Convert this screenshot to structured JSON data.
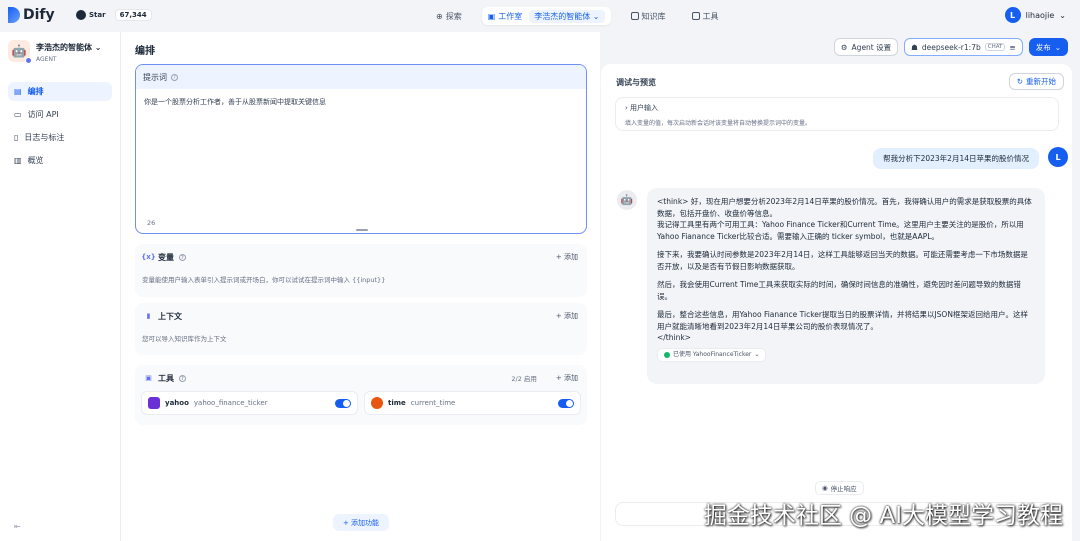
{
  "topbar": {
    "brand": "Dify",
    "star_label": "Star",
    "star_count": "67,344",
    "nav": [
      {
        "label": "探索"
      },
      {
        "label": "工作室",
        "pill": "李浩杰的智能体"
      },
      {
        "label": "知识库"
      },
      {
        "label": "工具"
      }
    ],
    "user_initial": "L",
    "user_name": "lihaojie"
  },
  "sidebar": {
    "app_name": "李浩杰的智能体",
    "app_type": "AGENT",
    "items": [
      {
        "label": "编排",
        "icon": "compose-icon"
      },
      {
        "label": "访问 API",
        "icon": "api-icon"
      },
      {
        "label": "日志与标注",
        "icon": "log-icon"
      },
      {
        "label": "概览",
        "icon": "overview-icon"
      }
    ]
  },
  "orchestrate": {
    "title": "编排",
    "prompt_label": "提示词",
    "prompt_text": "你是一个股票分析工作者，善于从股票新闻中提取关键信息",
    "prompt_count": "26",
    "variables": {
      "title": "变量",
      "add": "+ 添加",
      "desc": "变量能使用户输入表单引入提示词或开场白，你可以试试在提示词中输入 {{input}}"
    },
    "context": {
      "title": "上下文",
      "add": "+ 添加",
      "desc": "您可以导入知识库作为上下文"
    },
    "tools": {
      "title": "工具",
      "meta": "2/2 启用",
      "add": "+ 添加",
      "items": [
        {
          "name": "yahoo",
          "sub": "yahoo_finance_ticker",
          "color": "#6b2fd6"
        },
        {
          "name": "time",
          "sub": "current_time",
          "color": "#e8560f"
        }
      ]
    },
    "add_feature": "+ 添加功能"
  },
  "header_buttons": {
    "agent_settings": "Agent 设置",
    "model": "deepseek-r1:7b",
    "model_tag": "CHAT",
    "publish": "发布"
  },
  "preview": {
    "title": "调试与预览",
    "restart": "重新开始",
    "user_input_title": "用户输入",
    "user_input_desc": "填入变量的值，每次启动新会话时该变量将自动替换提示词中的变量。",
    "question": "帮我分析下2023年2月14日苹果的股价情况",
    "answer_p1": "<think> 好，现在用户想要分析2023年2月14日苹果的股价情况。首先，我得确认用户的需求是获取股票的具体数据，包括开盘价、收盘价等信息。",
    "answer_p1b": "我记得工具里有两个可用工具：Yahoo Finance Ticker和Current Time。这里用户主要关注的是股价，所以用Yahoo Fianance Ticker比较合适。需要输入正确的 ticker symbol，也就是AAPL。",
    "answer_p2": "接下来，我要确认时间参数是2023年2月14日，这样工具能够返回当天的数据。可能还需要考虑一下市场数据是否开放，以及是否有节假日影响数据获取。",
    "answer_p3": "然后，我会使用Current Time工具来获取实际的时间，确保时间信息的准确性，避免因时差问题导致的数据错误。",
    "answer_p4": "最后，整合这些信息，用Yahoo Fianance Ticker提取当日的股票详情，并将结果以JSON框架返回给用户。这样用户就能清晰地看到2023年2月14日苹果公司的股价表现情况了。",
    "answer_end": "</think>",
    "used_tool": "已使用 YahooFinanceTicker",
    "stop": "停止响应"
  },
  "watermark": "掘金技术社区 @ AI大模型学习教程"
}
